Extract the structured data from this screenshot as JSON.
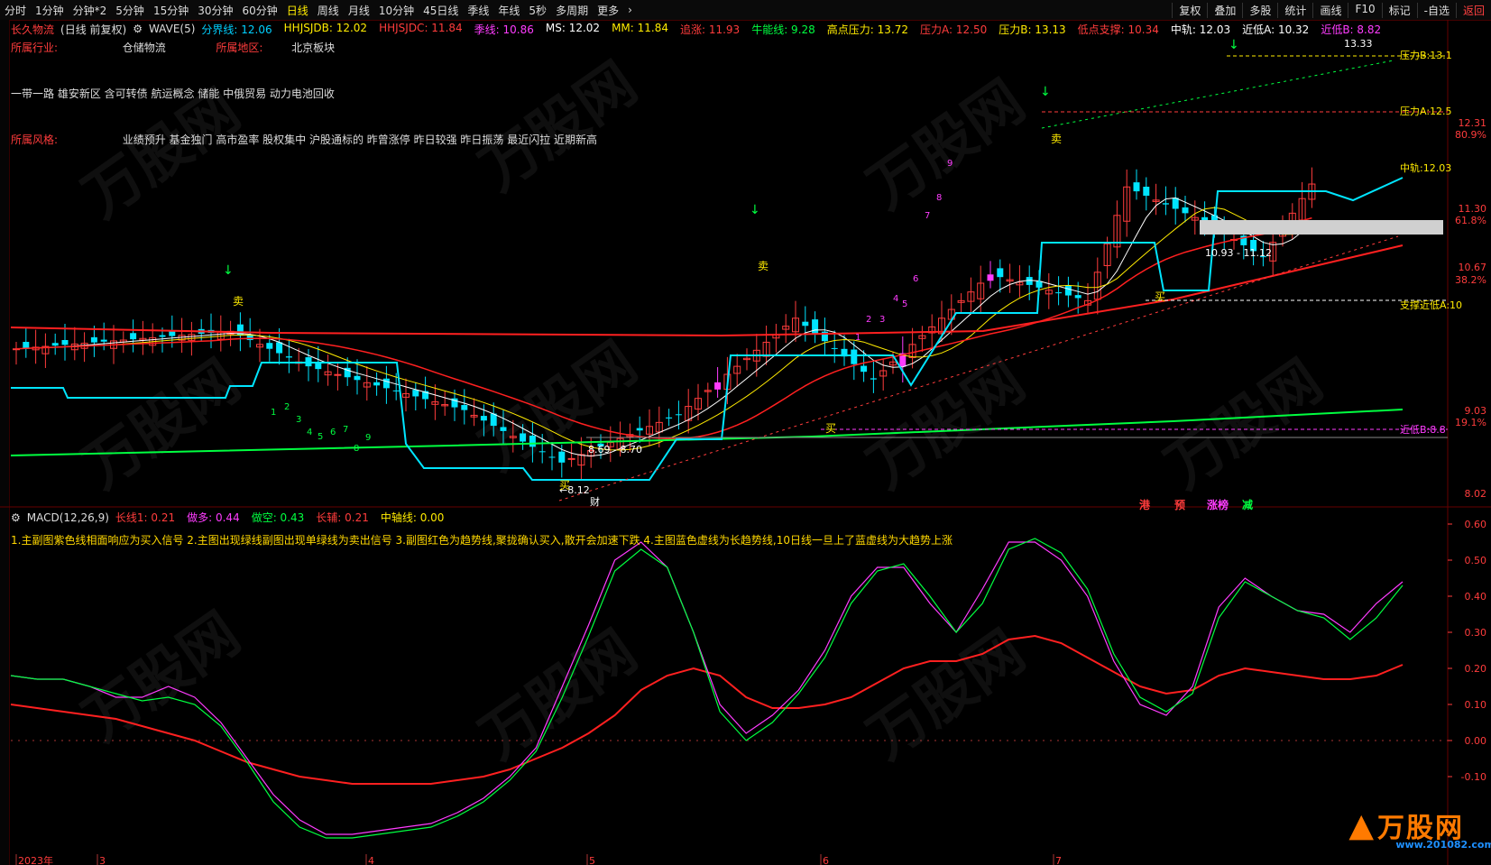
{
  "toolbar": {
    "periods": [
      "分时",
      "1分钟",
      "分钟*2",
      "5分钟",
      "15分钟",
      "30分钟",
      "60分钟",
      "日线",
      "周线",
      "月线",
      "10分钟",
      "45日线",
      "季线",
      "年线",
      "5秒",
      "多周期",
      "更多"
    ],
    "active": "日线",
    "right": [
      "复权",
      "叠加",
      "多股",
      "统计",
      "画线",
      "F10",
      "标记",
      "-自选"
    ],
    "back": "返回"
  },
  "stock": {
    "name": "长久物流",
    "mode": "(日线 前复权)",
    "indicator": "WAVE(5)",
    "fields": [
      {
        "text": "分界线: 12.06",
        "color": "#00d0ff"
      },
      {
        "text": "HHJSJDB: 12.02",
        "color": "#ffeb00"
      },
      {
        "text": "HHJSJDC: 11.84",
        "color": "#ff3c3c"
      },
      {
        "text": "季线: 10.86",
        "color": "#ff3cff"
      },
      {
        "text": "MS: 12.02",
        "color": "#ffffff"
      },
      {
        "text": "MM: 11.84",
        "color": "#ffeb00"
      },
      {
        "text": "追涨: 11.93",
        "color": "#ff3c3c"
      },
      {
        "text": "牛能线: 9.28",
        "color": "#00ff40"
      },
      {
        "text": "高点压力: 13.72",
        "color": "#ffeb00"
      },
      {
        "text": "压力A: 12.50",
        "color": "#ff3c3c"
      },
      {
        "text": "压力B: 13.13",
        "color": "#ffeb00"
      },
      {
        "text": "低点支撑: 10.34",
        "color": "#ff3c3c"
      },
      {
        "text": "中轨: 12.03",
        "color": "#ffffff"
      },
      {
        "text": "近低A: 10.32",
        "color": "#ffffff"
      },
      {
        "text": "近低B: 8.82",
        "color": "#ff3cff"
      }
    ]
  },
  "info": {
    "industry_label": "所属行业:",
    "industry": "仓储物流",
    "region_label": "所属地区:",
    "region": "北京板块",
    "concepts": "一带一路 雄安新区 含可转债 航运概念 储能 中俄贸易 动力电池回收",
    "style_label": "所属风格:",
    "style": "业绩预升 基金独门 高市盈率 股权集中 沪股通标的 昨曾涨停 昨日较强 昨日振荡 最近闪拉 近期新高"
  },
  "price_axis": [
    "12.31",
    "80.9%",
    "11.30",
    "61.8%",
    "10.67",
    "38.2%",
    "9.03",
    "19.1%",
    "8.02"
  ],
  "right_labels": [
    "压力B:13.1",
    "压力A:12.5",
    "中轨:12.03",
    "支撑近低A:10",
    "近低B:8.8"
  ],
  "annotations": {
    "high_price": "13.33",
    "low1": "8.12",
    "range1": "8.69 - 8.70",
    "range2": "10.93 - 11.12",
    "sell": "卖",
    "buy": "买",
    "cai": "财",
    "tags": [
      {
        "text": "港",
        "color": "#ff3c3c"
      },
      {
        "text": "预",
        "color": "#ff3c3c"
      },
      {
        "text": "涨榜",
        "color": "#ff3cff"
      },
      {
        "text": "减",
        "color": "#00ff40"
      }
    ]
  },
  "macd": {
    "name": "MACD(12,26,9)",
    "fields": [
      {
        "text": "长线1: 0.21",
        "color": "#ff3c3c"
      },
      {
        "text": "做多: 0.44",
        "color": "#ff3cff"
      },
      {
        "text": "做空: 0.43",
        "color": "#00ff40"
      },
      {
        "text": "长辅: 0.21",
        "color": "#ff3c3c"
      },
      {
        "text": "中轴线: 0.00",
        "color": "#ffeb00"
      }
    ],
    "note": "1.主副图紫色线相面响应为买入信号 2.主图出现绿线副图出现单绿线为卖出信号 3.副图红色为趋势线,聚拢确认买入,散开会加速下跌 4.主图蓝色虚线为长趋势线,10日线一旦上了蓝虚线为大趋势上涨",
    "axis": [
      "0.60",
      "0.50",
      "0.40",
      "0.30",
      "0.20",
      "0.10",
      "0.00",
      "-0.10"
    ]
  },
  "time_axis": [
    "2023年",
    "3",
    "4",
    "5",
    "6",
    "7"
  ],
  "logo": {
    "text": "万股网",
    "url": "www.201082.com"
  },
  "colors": {
    "up": "#ff3cff",
    "down": "#00e5ff",
    "ma_red": "#ff2020",
    "green": "#00ff40",
    "yellow": "#ffeb00"
  }
}
